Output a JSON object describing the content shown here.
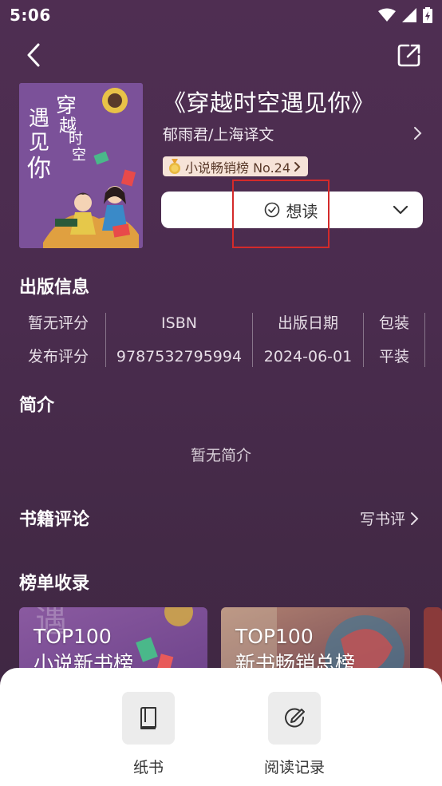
{
  "status_bar": {
    "time": "5:06"
  },
  "book": {
    "title": "《穿越时空遇见你》",
    "author_publisher": "郁雨君/上海译文",
    "rank_badge": "小说畅销榜 No.24",
    "want_read_label": "想读"
  },
  "cover": {
    "title_chars": [
      "穿",
      "越",
      "时",
      "空",
      "遇",
      "见",
      "你"
    ]
  },
  "publication": {
    "section_title": "出版信息",
    "columns": [
      {
        "top": "暂无评分",
        "bottom": "发布评分"
      },
      {
        "top": "ISBN",
        "bottom": "9787532795994"
      },
      {
        "top": "出版日期",
        "bottom": "2024-06-01"
      },
      {
        "top": "包装",
        "bottom": "平装"
      }
    ]
  },
  "intro": {
    "section_title": "简介",
    "empty_text": "暂无简介"
  },
  "reviews": {
    "section_title": "书籍评论",
    "write_label": "写书评"
  },
  "rankings": {
    "section_title": "榜单收录",
    "cards": [
      {
        "line1": "TOP100",
        "line2": "小说新书榜",
        "color": "#8a5aa0"
      },
      {
        "line1": "TOP100",
        "line2": "新书畅销总榜",
        "color": "#a07060"
      }
    ]
  },
  "bottom_sheet": {
    "paper_book_label": "纸书",
    "reading_record_label": "阅读记录"
  },
  "colors": {
    "background": "#4a2c4e",
    "highlight": "#d42a2a",
    "badge_bg": "#f6e3d8"
  }
}
